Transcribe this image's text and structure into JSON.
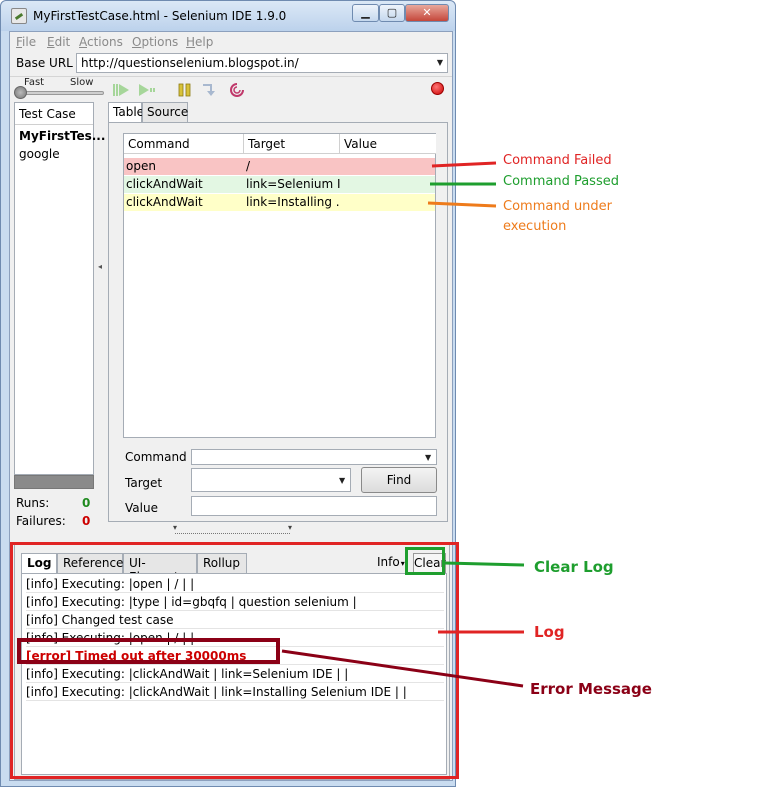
{
  "window": {
    "title": "MyFirstTestCase.html - Selenium IDE 1.9.0",
    "min_glyph": "▁",
    "max_glyph": "▢",
    "close_glyph": "✕"
  },
  "menu": {
    "file": {
      "u": "F",
      "rest": "ile"
    },
    "edit": {
      "u": "E",
      "rest": "dit"
    },
    "actions": {
      "u": "A",
      "rest": "ctions"
    },
    "options": {
      "u": "O",
      "rest": "ptions"
    },
    "help": {
      "u": "H",
      "rest": "elp"
    }
  },
  "base_url": {
    "label": "Base URL",
    "value": "http://questionselenium.blogspot.in/"
  },
  "toolbar": {
    "speed_fast": "Fast",
    "speed_slow": "Slow",
    "icons": [
      "play-all-icon",
      "play-current-icon",
      "pause-icon",
      "step-icon",
      "rollup-icon",
      "record-icon"
    ]
  },
  "test_case_panel": {
    "header": "Test Case",
    "items": [
      "MyFirstTes...",
      "google"
    ],
    "runs_label": "Runs:",
    "runs_value": "0",
    "failures_label": "Failures:",
    "failures_value": "0"
  },
  "editor": {
    "tabs": [
      "Table",
      "Source"
    ],
    "columns": [
      "Command",
      "Target",
      "Value"
    ],
    "rows": [
      {
        "command": "open",
        "target": "/",
        "value": "",
        "status": "failed",
        "color": "#f9c4c4"
      },
      {
        "command": "clickAndWait",
        "target": "link=Selenium I...",
        "value": "",
        "status": "passed",
        "color": "#e3f7e3"
      },
      {
        "command": "clickAndWait",
        "target": "link=Installing ...",
        "value": "",
        "status": "running",
        "color": "#ffffc8"
      }
    ],
    "field_command": "Command",
    "field_target": "Target",
    "field_value": "Value",
    "find_label": "Find"
  },
  "log_panel": {
    "tabs": [
      "Log",
      "Reference",
      "UI-Element",
      "Rollup"
    ],
    "info_filter": "Info",
    "clear_label": "Clear",
    "lines": [
      "[info] Executing: |open | / | |",
      "[info] Executing: |type | id=gbqfq | question selenium |",
      "[info] Changed test case",
      "[info] Executing: |open | / | |",
      "[error] Timed out after 30000ms",
      "[info] Executing: |clickAndWait | link=Selenium IDE | |",
      "[info] Executing: |clickAndWait | link=Installing Selenium IDE | |"
    ]
  },
  "annotations": {
    "command_failed": "Command Failed",
    "command_passed": "Command Passed",
    "command_running": "Command under execution",
    "clear_log": "Clear Log",
    "log": "Log",
    "error_message": "Error Message",
    "colors": {
      "red": "#e02424",
      "green": "#1e9e2e",
      "orange": "#ee7b1b",
      "maroon": "#8b0016"
    }
  }
}
